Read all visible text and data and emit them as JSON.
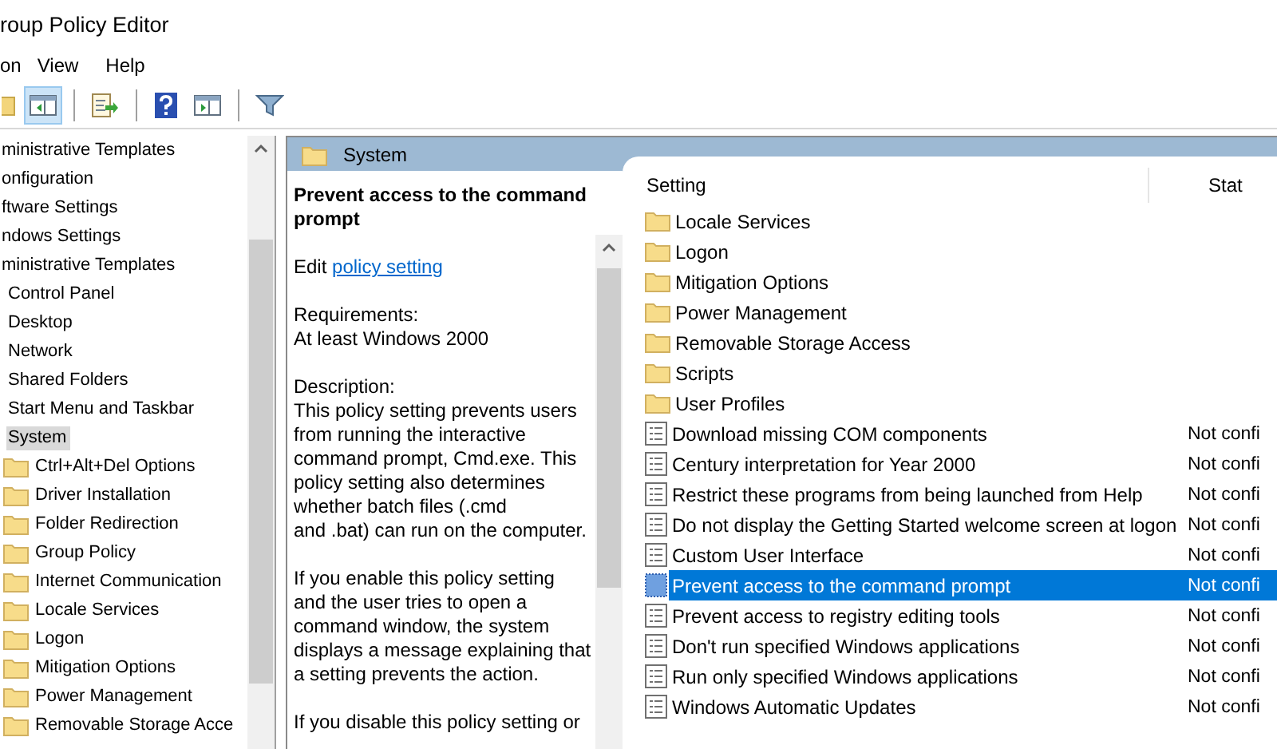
{
  "window": {
    "title": "roup Policy Editor"
  },
  "menu": [
    "on",
    "View",
    "Help"
  ],
  "toolbar": [
    {
      "kind": "folder",
      "selected": false
    },
    {
      "kind": "pane-back",
      "selected": true
    },
    {
      "kind": "export",
      "selected": false
    },
    {
      "kind": "help",
      "selected": false
    },
    {
      "kind": "pane-forward",
      "selected": false
    },
    {
      "kind": "filter",
      "selected": false
    }
  ],
  "tree": [
    {
      "label": "ministrative Templates",
      "selected": false
    },
    {
      "label": "onfiguration",
      "selected": false,
      "children": [
        {
          "label": "ftware Settings",
          "selected": false
        },
        {
          "label": "ndows Settings",
          "selected": false
        },
        {
          "label": "ministrative Templates",
          "selected": false,
          "children": [
            {
              "label": "Control Panel",
              "selected": false
            },
            {
              "label": "Desktop",
              "selected": false
            },
            {
              "label": "Network",
              "selected": false
            },
            {
              "label": "Shared Folders",
              "selected": false
            },
            {
              "label": "Start Menu and Taskbar",
              "selected": false
            },
            {
              "label": "System",
              "selected": true,
              "children": [
                {
                  "label": "Ctrl+Alt+Del Options",
                  "selected": false
                },
                {
                  "label": "Driver Installation",
                  "selected": false
                },
                {
                  "label": "Folder Redirection",
                  "selected": false
                },
                {
                  "label": "Group Policy",
                  "selected": false
                },
                {
                  "label": "Internet Communication",
                  "selected": false
                },
                {
                  "label": "Locale Services",
                  "selected": false
                },
                {
                  "label": "Logon",
                  "selected": false
                },
                {
                  "label": "Mitigation Options",
                  "selected": false
                },
                {
                  "label": "Power Management",
                  "selected": false
                },
                {
                  "label": "Removable Storage Acce",
                  "selected": false
                }
              ]
            }
          ]
        }
      ]
    }
  ],
  "description": {
    "header": "System",
    "title": "Prevent access to the command prompt",
    "edit_label": "Edit",
    "edit_link": "policy setting ",
    "blocks": [
      [
        "Requirements:",
        "At least Windows 2000"
      ],
      [
        "Description:",
        "This policy setting prevents users",
        "from running the interactive",
        "command prompt, Cmd.exe.  This",
        "policy setting also determines",
        "whether batch files (.cmd",
        "and .bat) can run on the computer."
      ],
      [
        "If you enable this policy setting",
        "and the user tries to open a",
        "command window, the system",
        "displays a message explaining that",
        "a setting prevents the action."
      ],
      [
        "If you disable this policy setting or"
      ]
    ]
  },
  "list": {
    "columns": [
      "Setting",
      "Stat"
    ],
    "rows": [
      {
        "kind": "folder",
        "name": "Locale Services",
        "selected": false
      },
      {
        "kind": "folder",
        "name": "Logon",
        "selected": false
      },
      {
        "kind": "folder",
        "name": "Mitigation Options",
        "selected": false
      },
      {
        "kind": "folder",
        "name": "Power Management",
        "selected": false
      },
      {
        "kind": "folder",
        "name": "Removable Storage Access",
        "selected": false
      },
      {
        "kind": "folder",
        "name": "Scripts",
        "selected": false
      },
      {
        "kind": "folder",
        "name": "User Profiles",
        "selected": false
      },
      {
        "kind": "setting",
        "name": "Download missing COM components",
        "state": "Not confi",
        "selected": false
      },
      {
        "kind": "setting",
        "name": "Century interpretation for Year 2000",
        "state": "Not confi",
        "selected": false
      },
      {
        "kind": "setting",
        "name": "Restrict these programs from being launched from Help",
        "state": "Not confi",
        "selected": false
      },
      {
        "kind": "setting",
        "name": "Do not display the Getting Started welcome screen at logon",
        "state": "Not confi",
        "selected": false
      },
      {
        "kind": "setting",
        "name": "Custom User Interface",
        "state": "Not confi",
        "selected": false
      },
      {
        "kind": "setting",
        "name": "Prevent access to the command prompt",
        "state": "Not confi",
        "selected": true
      },
      {
        "kind": "setting",
        "name": "Prevent access to registry editing tools",
        "state": "Not confi",
        "selected": false
      },
      {
        "kind": "setting",
        "name": "Don't run specified Windows applications",
        "state": "Not confi",
        "selected": false
      },
      {
        "kind": "setting",
        "name": "Run only specified Windows applications",
        "state": "Not confi",
        "selected": false
      },
      {
        "kind": "setting",
        "name": "Windows Automatic Updates",
        "state": "Not confi",
        "selected": false
      }
    ]
  }
}
